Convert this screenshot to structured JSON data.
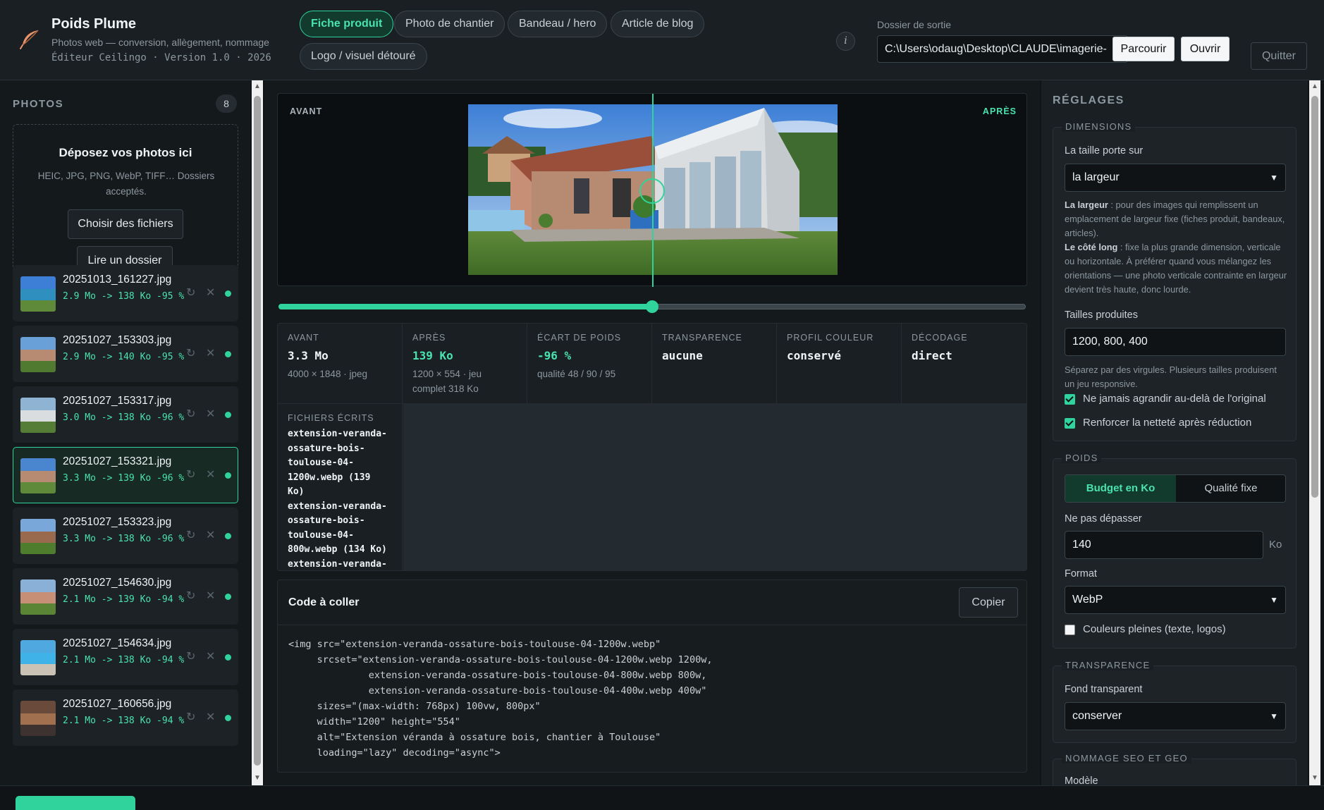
{
  "app": {
    "title": "Poids Plume",
    "subtitle": "Photos web — conversion, allègement, nommage",
    "version_line": "Éditeur Ceilingo · Version 1.0 · 2026"
  },
  "header": {
    "modes": [
      {
        "label": "Fiche produit",
        "active": true
      },
      {
        "label": "Photo de chantier",
        "active": false
      },
      {
        "label": "Bandeau / hero",
        "active": false
      },
      {
        "label": "Article de blog",
        "active": false
      },
      {
        "label": "Logo / visuel détouré",
        "active": false
      }
    ],
    "info_glyph": "i",
    "output_label": "Dossier de sortie",
    "output_path": "C:\\Users\\odaug\\Desktop\\CLAUDE\\imagerie-",
    "browse_label": "Parcourir",
    "open_label": "Ouvrir",
    "quit_label": "Quitter"
  },
  "photos": {
    "title": "PHOTOS",
    "count": "8",
    "drop_title": "Déposez vos photos ici",
    "drop_desc": "HEIC, JPG, PNG, WebP, TIFF… Dossiers acceptés.",
    "choose_files": "Choisir des fichiers",
    "read_folder": "Lire un dossier",
    "items": [
      {
        "name": "20251013_161227.jpg",
        "stats": "2.9 Mo -> 138 Ko -95 %"
      },
      {
        "name": "20251027_153303.jpg",
        "stats": "2.9 Mo -> 140 Ko -95 %"
      },
      {
        "name": "20251027_153317.jpg",
        "stats": "3.0 Mo -> 138 Ko -96 %"
      },
      {
        "name": "20251027_153321.jpg",
        "stats": "3.3 Mo -> 139 Ko -96 %"
      },
      {
        "name": "20251027_153323.jpg",
        "stats": "3.3 Mo -> 138 Ko -96 %"
      },
      {
        "name": "20251027_154630.jpg",
        "stats": "2.1 Mo -> 139 Ko -94 %"
      },
      {
        "name": "20251027_154634.jpg",
        "stats": "2.1 Mo -> 138 Ko -94 %"
      },
      {
        "name": "20251027_160656.jpg",
        "stats": "2.1 Mo -> 138 Ko -94 %"
      }
    ],
    "selected_index": 3
  },
  "compare": {
    "before_label": "AVANT",
    "after_label": "APRÈS",
    "slider_fraction": 0.5
  },
  "stats": {
    "before": {
      "label": "AVANT",
      "value": "3.3 Mo",
      "sub": "4000 × 1848 · jpeg"
    },
    "after": {
      "label": "APRÈS",
      "value": "139 Ko",
      "sub": "1200 × 554 · jeu complet 318 Ko"
    },
    "diff": {
      "label": "ÉCART DE POIDS",
      "value": "-96 %",
      "sub": "qualité 48 / 90 / 95"
    },
    "transparency": {
      "label": "TRANSPARENCE",
      "value": "aucune"
    },
    "color_profile": {
      "label": "PROFIL COULEUR",
      "value": "conservé"
    },
    "decoding": {
      "label": "DÉCODAGE",
      "value": "direct"
    },
    "files_written_label": "FICHIERS ÉCRITS",
    "files_written_text": "extension-veranda-\nossature-bois-\ntoulouse-04-\n1200w.webp (139\nKo)\nextension-veranda-\nossature-bois-\ntoulouse-04-\n800w.webp (134 Ko)\nextension-veranda-"
  },
  "code": {
    "title": "Code à coller",
    "copy_label": "Copier",
    "snippet": "<img src=\"extension-veranda-ossature-bois-toulouse-04-1200w.webp\"\n     srcset=\"extension-veranda-ossature-bois-toulouse-04-1200w.webp 1200w,\n              extension-veranda-ossature-bois-toulouse-04-800w.webp 800w,\n              extension-veranda-ossature-bois-toulouse-04-400w.webp 400w\"\n     sizes=\"(max-width: 768px) 100vw, 800px\"\n     width=\"1200\" height=\"554\"\n     alt=\"Extension véranda à ossature bois, chantier à Toulouse\"\n     loading=\"lazy\" decoding=\"async\">"
  },
  "settings": {
    "title": "RÉGLAGES",
    "dimensions": {
      "legend": "DIMENSIONS",
      "size_on_label": "La taille porte sur",
      "size_on_value": "la largeur",
      "help_width_bold": "La largeur",
      "help_width": " : pour des images qui remplissent un emplacement de largeur fixe (fiches produit, bandeaux, articles).",
      "help_long_bold": "Le côté long",
      "help_long": " : fixe la plus grande dimension, verticale ou horizontale. À préférer quand vous mélangez les orientations — une photo verticale contrainte en largeur devient très haute, donc lourde.",
      "sizes_label": "Tailles produites",
      "sizes_value": "1200, 800, 400",
      "sizes_help": "Séparez par des virgules. Plusieurs tailles produisent un jeu responsive.",
      "no_upscale": "Ne jamais agrandir au-delà de l'original",
      "no_upscale_checked": true,
      "sharpen": "Renforcer la netteté après réduction",
      "sharpen_checked": true
    },
    "weight": {
      "legend": "POIDS",
      "mode_a": "Budget en Ko",
      "mode_b": "Qualité fixe",
      "max_label": "Ne pas dépasser",
      "max_value": "140",
      "unit": "Ko",
      "format_label": "Format",
      "format_value": "WebP",
      "flat_colors": "Couleurs pleines (texte, logos)",
      "flat_colors_checked": false
    },
    "transparency": {
      "legend": "TRANSPARENCE",
      "bg_label": "Fond transparent",
      "bg_value": "conserver"
    },
    "naming": {
      "legend": "NOMMAGE SEO ET GEO",
      "model_label": "Modèle"
    }
  },
  "colors": {
    "accent": "#2fd39b",
    "background": "#101417",
    "panel": "#1a1f23"
  }
}
